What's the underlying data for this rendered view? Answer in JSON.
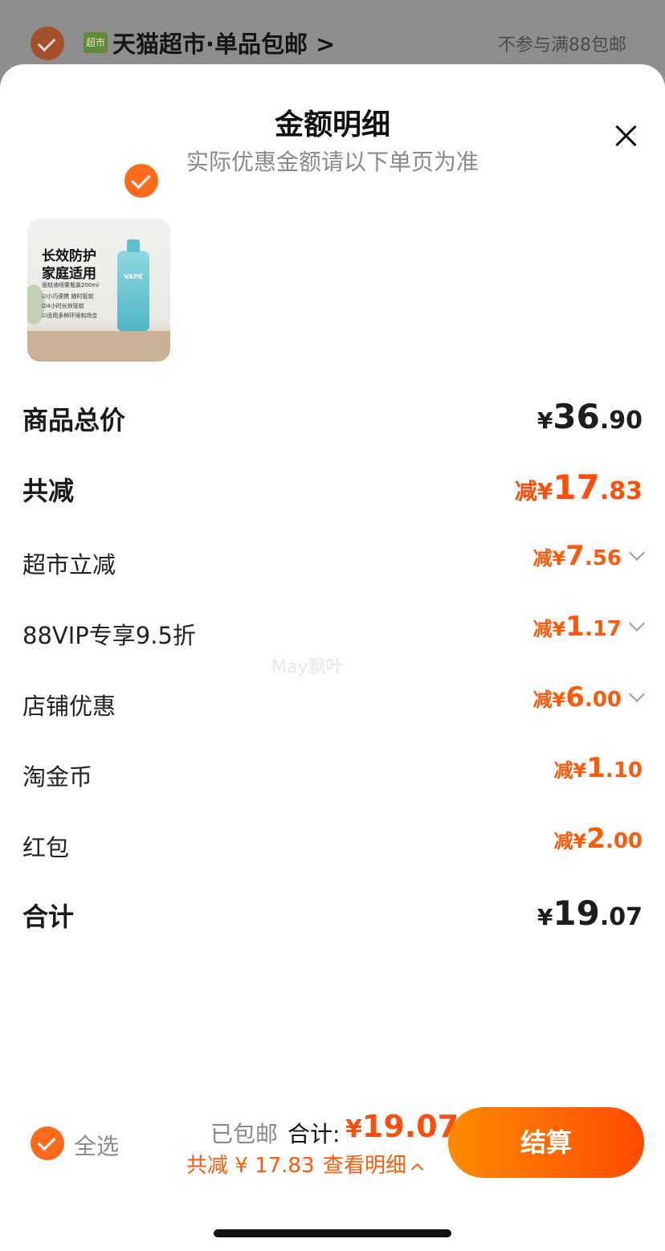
{
  "top_bar": {
    "logo_text": "超市",
    "store_name": "天猫超市·单品包邮 >",
    "note": "不参与满88包邮"
  },
  "sheet": {
    "title": "金额明细",
    "subtitle": "实际优惠金额请以下单页为准"
  },
  "product": {
    "image_text_line1": "长效防护",
    "image_text_line2": "家庭适用",
    "image_lines": [
      "驱蚊液喷雾瓶装200ml",
      "☑小巧便携 随时驱蚊",
      "☑4小时长效驱蚊",
      "☑适用多种环境和场合"
    ],
    "bottle_label": "VAPE"
  },
  "rows": {
    "subtotal": {
      "label": "商品总价",
      "prefix": "¥",
      "int": "36",
      "dec": ".90"
    },
    "total_discount": {
      "label": "共减",
      "prefix": "减¥",
      "int": "17",
      "dec": ".83"
    },
    "discounts": [
      {
        "label": "超市立减",
        "prefix": "减¥",
        "int": "7",
        "dec": ".56"
      },
      {
        "label": "88VIP专享9.5折",
        "prefix": "减¥",
        "int": "1",
        "dec": ".17"
      },
      {
        "label": "店铺优惠",
        "prefix": "减¥",
        "int": "6",
        "dec": ".00"
      },
      {
        "label": "淘金币",
        "prefix": "减¥",
        "int": "1",
        "dec": ".10"
      },
      {
        "label": "红包",
        "prefix": "减¥",
        "int": "2",
        "dec": ".00"
      }
    ],
    "total": {
      "label": "合计",
      "prefix": "¥",
      "int": "19",
      "dec": ".07"
    }
  },
  "watermark": "May飘叶",
  "bottom": {
    "select_all": "全选",
    "free_shipping": "已包邮",
    "total_label": "合计:",
    "total_prefix": "¥",
    "total_value": "19.07",
    "saving_text": "共减 ¥ 17.83",
    "detail_link": "查看明细",
    "checkout": "结算"
  },
  "colors": {
    "accent": "#ff5a0a",
    "discount": "#ff4d0d",
    "checkout_gradient": [
      "#ff8a00",
      "#ff4a00"
    ]
  }
}
